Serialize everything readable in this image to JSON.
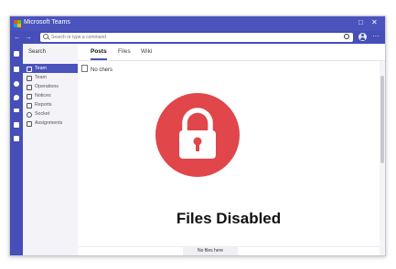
{
  "window": {
    "title": "Microsoft Teams",
    "minimize": "□",
    "close": "✕"
  },
  "topbar": {
    "back": "←",
    "forward": "→",
    "search_placeholder": "Search or type a command",
    "more": "···"
  },
  "sidebar": {
    "header": "Search",
    "items": [
      {
        "label": "Team",
        "active": true
      },
      {
        "label": "Team",
        "active": false
      },
      {
        "label": "Operations",
        "active": false
      },
      {
        "label": "Notices",
        "active": false
      },
      {
        "label": "Reports",
        "active": false
      },
      {
        "label": "Socket",
        "active": false
      },
      {
        "label": "Assignments",
        "active": false
      }
    ]
  },
  "tabs": [
    {
      "label": "Posts"
    },
    {
      "label": "Files"
    },
    {
      "label": "Wiki"
    }
  ],
  "content": {
    "sub_item": "No chers",
    "headline": "Files Disabled",
    "footer_label": "No files here"
  },
  "colors": {
    "accent": "#4b53bc",
    "lock_circle": "#e0464a"
  }
}
